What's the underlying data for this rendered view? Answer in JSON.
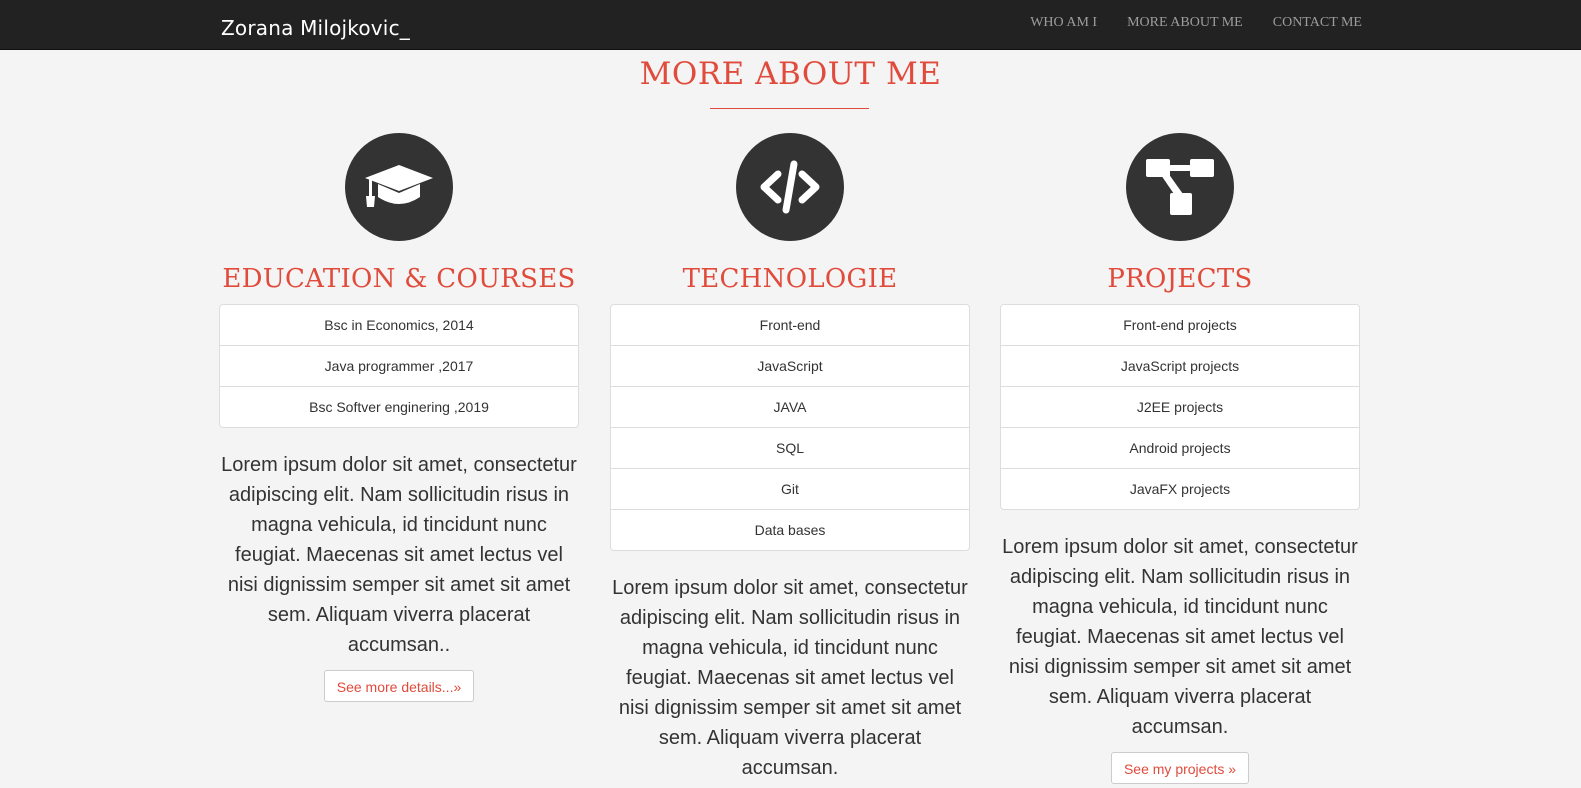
{
  "navbar": {
    "brand": "Zorana Milojkovic_",
    "links": [
      "WHO AM I",
      "MORE ABOUT ME",
      "CONTACT ME"
    ]
  },
  "section": {
    "title": "MORE ABOUT ME"
  },
  "columns": [
    {
      "icon": "graduation-cap-icon",
      "heading": "EDUCATION & COURSES",
      "items": [
        "Bsc in Economics, 2014",
        "Java programmer ,2017",
        "Bsc Softver enginering ,2019"
      ],
      "text": "Lorem ipsum dolor sit amet, consectetur adipiscing elit. Nam sollicitudin risus in magna vehicula, id tincidunt nunc feugiat. Maecenas sit amet lectus vel nisi dignissim semper sit amet sit amet sem. Aliquam viverra placerat accumsan..",
      "button": "See more details...»"
    },
    {
      "icon": "code-icon",
      "heading": "TECHNOLOGIE",
      "items": [
        "Front-end",
        "JavaScript",
        "JAVA",
        "SQL",
        "Git",
        "Data bases"
      ],
      "text": "Lorem ipsum dolor sit amet, consectetur adipiscing elit. Nam sollicitudin risus in magna vehicula, id tincidunt nunc feugiat. Maecenas sit amet lectus vel nisi dignissim semper sit amet sit amet sem. Aliquam viverra placerat accumsan."
    },
    {
      "icon": "sitemap-icon",
      "heading": "PROJECTS",
      "items": [
        "Front-end projects",
        "JavaScript projects",
        "J2EE projects",
        "Android projects",
        "JavaFX projects"
      ],
      "text": "Lorem ipsum dolor sit amet, consectetur adipiscing elit. Nam sollicitudin risus in magna vehicula, id tincidunt nunc feugiat. Maecenas sit amet lectus vel nisi dignissim semper sit amet sit amet sem. Aliquam viverra placerat accumsan.",
      "button": "See my projects »"
    }
  ],
  "colors": {
    "accent": "#e04b3c",
    "navbar": "#222222",
    "icon_bg": "#333333",
    "background": "#f4f4f4"
  }
}
